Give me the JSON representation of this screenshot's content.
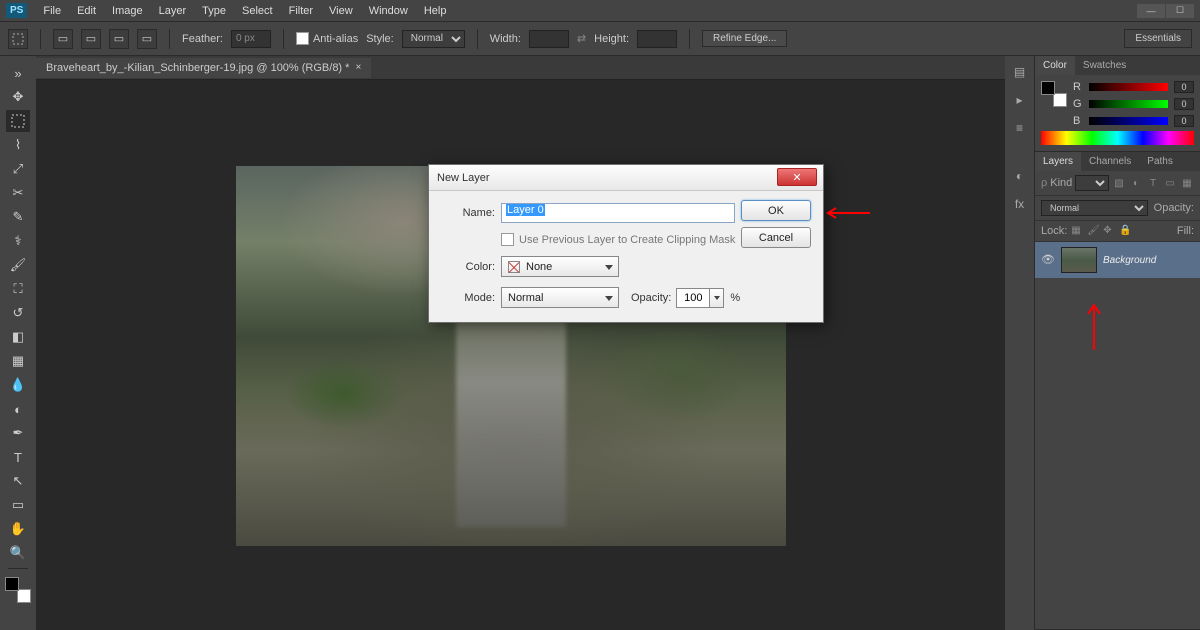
{
  "app": {
    "logo": "PS"
  },
  "menus": [
    "File",
    "Edit",
    "Image",
    "Layer",
    "Type",
    "Select",
    "Filter",
    "View",
    "Window",
    "Help"
  ],
  "optbar": {
    "feather_label": "Feather:",
    "feather_value": "0 px",
    "aa": "Anti-alias",
    "style_label": "Style:",
    "style_value": "Normal",
    "width_label": "Width:",
    "height_label": "Height:",
    "refine": "Refine Edge...",
    "essentials": "Essentials"
  },
  "doc": {
    "tab": "Braveheart_by_-Kilian_Schinberger-19.jpg @ 100% (RGB/8) *"
  },
  "panels": {
    "color": {
      "tab": "Color",
      "swatches": "Swatches",
      "r": "R",
      "g": "G",
      "b": "B",
      "zero": "0"
    },
    "layers": {
      "tab": "Layers",
      "channels": "Channels",
      "paths": "Paths",
      "kind": "Kind",
      "blend": "Normal",
      "opacity_lab": "Opacity:",
      "lock": "Lock:",
      "fill": "Fill:",
      "layer_name": "Background"
    }
  },
  "dialog": {
    "title": "New Layer",
    "name_label": "Name:",
    "name_value": "Layer 0",
    "clip": "Use Previous Layer to Create Clipping Mask",
    "color_label": "Color:",
    "color_value": "None",
    "mode_label": "Mode:",
    "mode_value": "Normal",
    "opacity_label": "Opacity:",
    "opacity_value": "100",
    "pct": "%",
    "ok": "OK",
    "cancel": "Cancel"
  }
}
